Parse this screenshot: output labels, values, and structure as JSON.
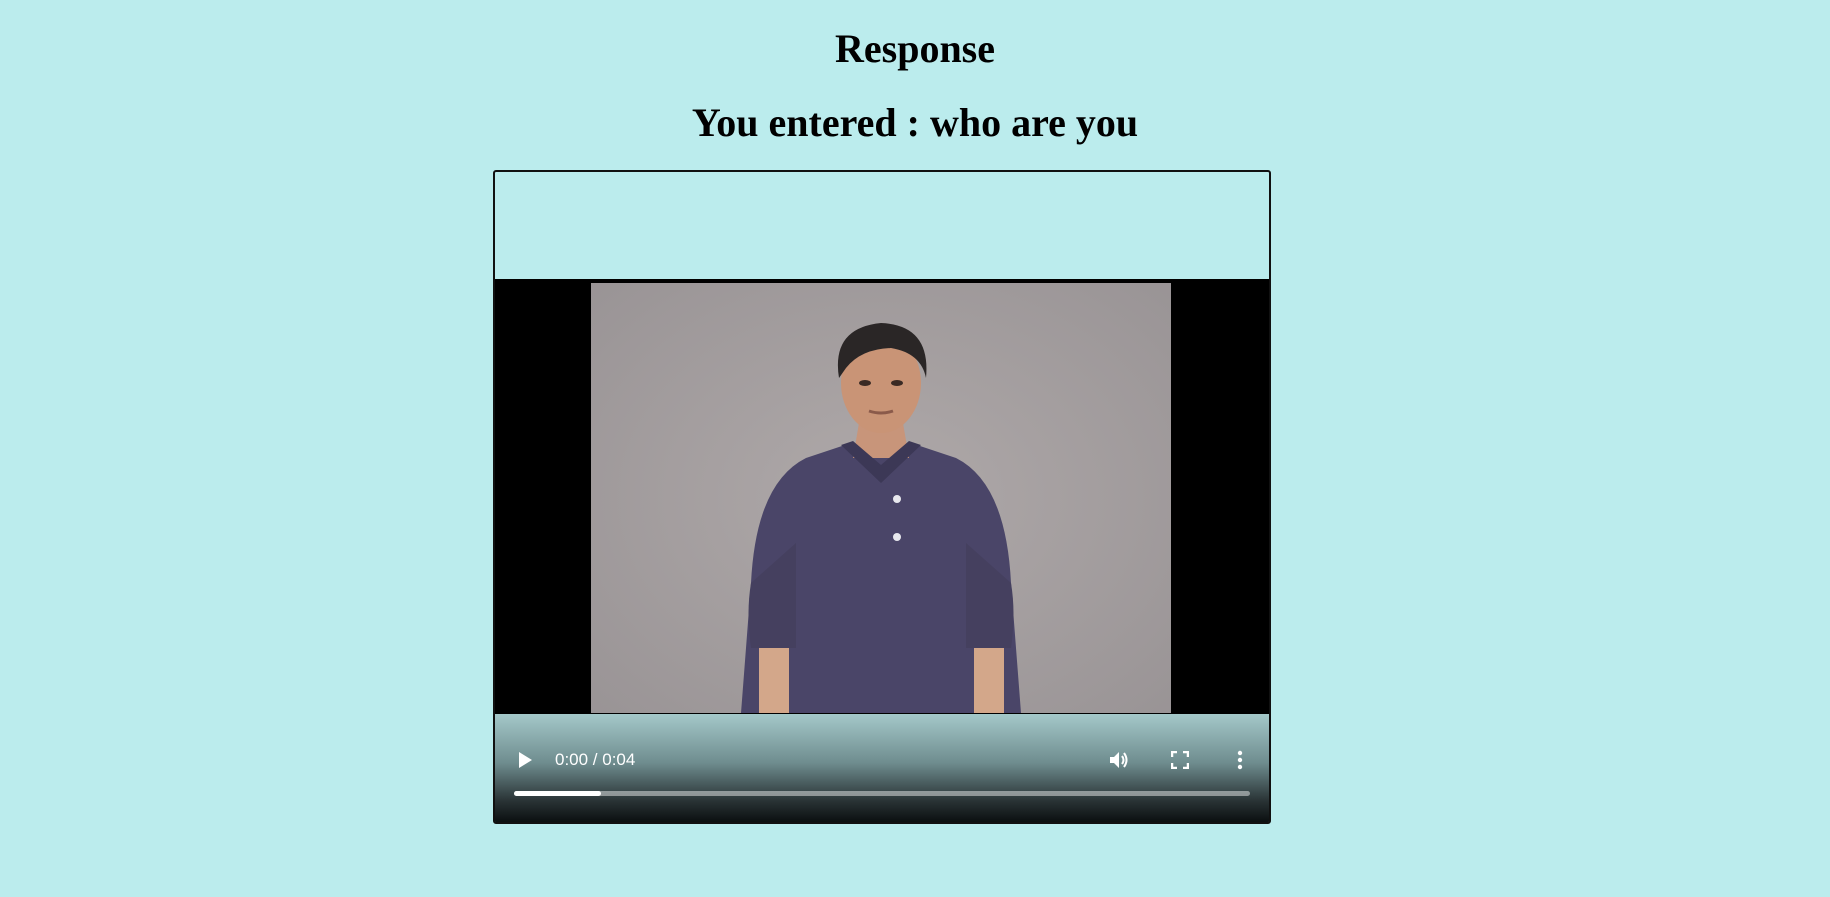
{
  "page": {
    "heading": "Response",
    "entered_text": "You entered : who are you"
  },
  "player": {
    "time_display": "0:00 / 0:04",
    "progress_fraction": 0.118,
    "icons": {
      "play": "play-icon",
      "volume": "volume-icon",
      "fullscreen": "fullscreen-icon",
      "more": "more-vertical-icon"
    },
    "colors": {
      "background": "#bbeced",
      "controls_text": "#ffffff"
    }
  }
}
